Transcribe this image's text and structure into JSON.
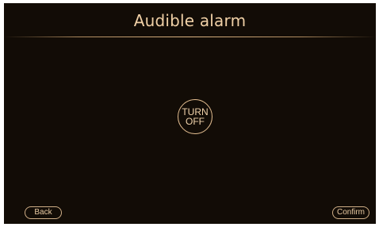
{
  "screen": {
    "title": "Audible alarm"
  },
  "toggle": {
    "line1": "TURN",
    "line2": "OFF"
  },
  "footer": {
    "back_label": "Back",
    "confirm_label": "Confirm"
  },
  "colors": {
    "background": "#120c06",
    "accent": "#e6c092",
    "text": "#f0d0a6"
  }
}
